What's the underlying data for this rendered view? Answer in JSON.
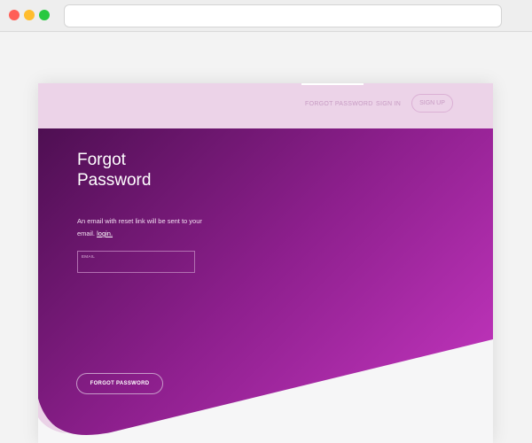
{
  "browser": {
    "address": ""
  },
  "nav": {
    "forgot_password": "FORGOT PASSWORD",
    "sign_in": "SIGN IN",
    "sign_up": "SIGN UP"
  },
  "hero": {
    "title_line1": "Forgot",
    "title_line2": "Password",
    "description": "An email with reset link will be sent to your email.",
    "description_link": "login."
  },
  "form": {
    "email_label": "EMAIL",
    "email_value": "",
    "submit_label": "FORGOT PASSWORD"
  },
  "colors": {
    "gradient_start": "#4e0f52",
    "gradient_mid": "#8d1f8d",
    "gradient_end": "#c938c4",
    "nav_background": "#ecd3e8"
  }
}
